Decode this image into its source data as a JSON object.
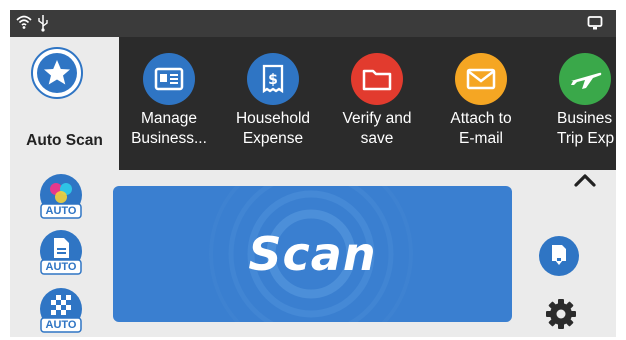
{
  "status_bar": {
    "icons": [
      "wifi-icon",
      "usb-icon",
      "screen-icon"
    ]
  },
  "auto_scan": {
    "label": "Auto Scan",
    "icon": "star-icon"
  },
  "profiles": [
    {
      "line1": "Manage",
      "line2": "Business...",
      "color": "#2f75c4",
      "icon": "business-card-icon"
    },
    {
      "line1": "Household",
      "line2": "Expense",
      "color": "#2f75c4",
      "icon": "receipt-icon"
    },
    {
      "line1": "Verify and",
      "line2": "save",
      "color": "#e23b2e",
      "icon": "folder-icon"
    },
    {
      "line1": "Attach to",
      "line2": "E-mail",
      "color": "#f5a623",
      "icon": "email-icon"
    },
    {
      "line1": "Busines",
      "line2": "Trip Exp",
      "color": "#3aa84a",
      "icon": "airplane-icon"
    }
  ],
  "quality_buttons": [
    {
      "badge": "AUTO",
      "icon": "color-mode-icon"
    },
    {
      "badge": "AUTO",
      "icon": "paper-size-icon"
    },
    {
      "badge": "AUTO",
      "icon": "resolution-icon"
    }
  ],
  "scan_button": {
    "label": "Scan"
  },
  "side_buttons": {
    "collapse_icon": "chevron-up-icon",
    "feed_icon": "feed-mode-icon",
    "settings_icon": "gear-icon"
  },
  "colors": {
    "accent": "#2f75c4",
    "scan_bg": "#3a7fd0",
    "strip_bg": "#2b2b2b",
    "status_bg": "#3b3b3b"
  }
}
